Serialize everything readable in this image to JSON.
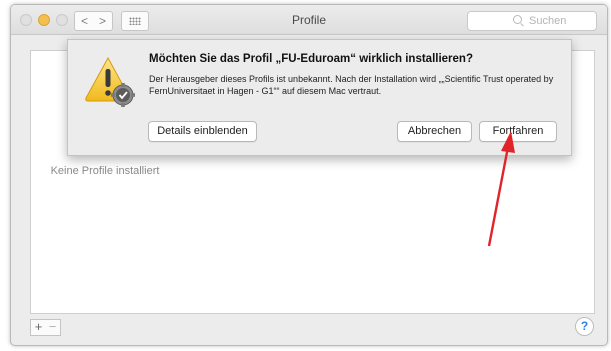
{
  "window": {
    "title": "Profile",
    "nav_back": "<",
    "nav_forward": ">",
    "search_placeholder": "Suchen"
  },
  "sidebar": {
    "empty_text": "Keine Profile installiert"
  },
  "footer": {
    "add_label": "+",
    "remove_label": "−",
    "help_label": "?"
  },
  "dialog": {
    "headline": "Möchten Sie das Profil „FU-Eduroam“ wirklich installieren?",
    "message": "Der Herausgeber dieses Profils ist unbekannt. Nach der Installation wird „„Scientific Trust operated by FernUniversitaet in Hagen - G1““ auf diesem Mac vertraut.",
    "buttons": {
      "details": "Details einblenden",
      "cancel": "Abbrechen",
      "continue": "Fortfahren"
    }
  },
  "colors": {
    "annotation_arrow": "#e0242a",
    "warning_yellow": "#f6c52a",
    "help_blue": "#2f83e3"
  },
  "icons": {
    "dialog": "warning-triangle-with-gear-icon",
    "search": "magnifier-icon",
    "grid": "grid-icon"
  }
}
